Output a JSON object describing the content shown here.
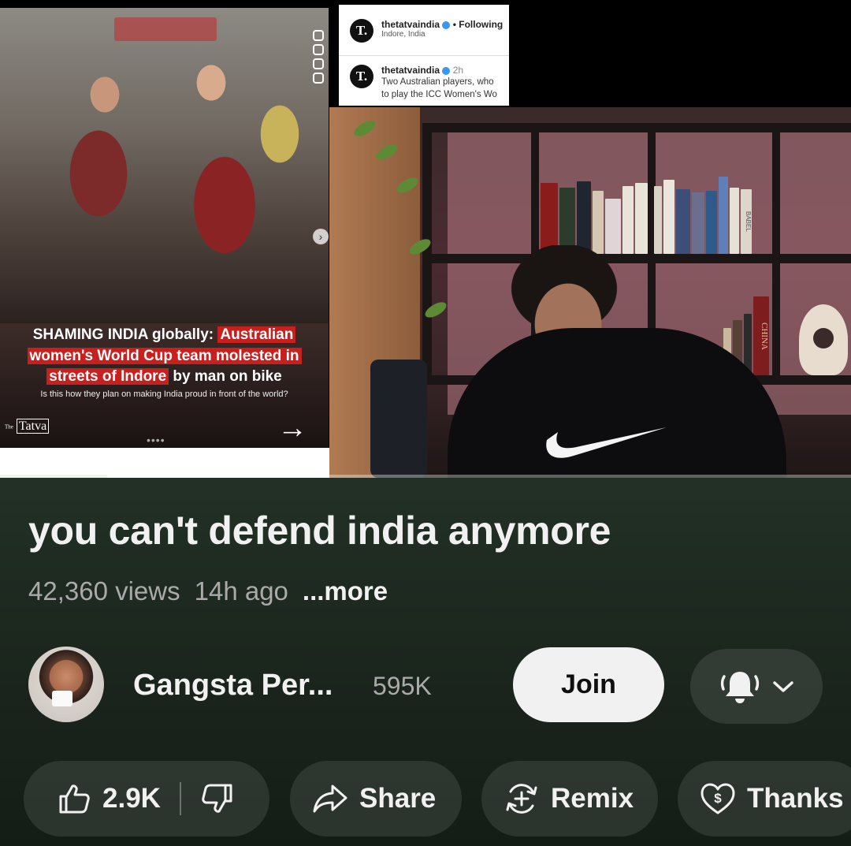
{
  "video": {
    "post_header": {
      "account": "thetatvaindia",
      "follow_status": "Following",
      "location": "Indore, India",
      "caption_account": "thetatvaindia",
      "caption_time": "2h",
      "caption_line1": "Two Australian players, who",
      "caption_line2": "to play the ICC Women's Wo"
    },
    "post": {
      "headline_part1": "SHAMING INDIA globally: ",
      "headline_hl1": "Australian",
      "headline_hl2": "women's World Cup team molested in",
      "headline_hl3": "streets of Indore",
      "headline_part4": " by man on bike",
      "subline": "Is this how they plan on making India proud in front of the world?",
      "logo_text": "Tatva",
      "logo_prefix": "The",
      "arrow": "→",
      "dots": "••••"
    },
    "studio": {
      "book_spine_1": "BABEL",
      "book_spine_2": "CHINA"
    },
    "progress_fraction": 0.126
  },
  "title": "you can't defend india anymore",
  "meta": {
    "views": "42,360 views",
    "age": "14h ago",
    "more": "...more"
  },
  "channel": {
    "name": "Gangsta Per...",
    "subscribers": "595K",
    "join_label": "Join",
    "bell_icon": "bell-ringing-icon",
    "chevron_icon": "chevron-down-icon"
  },
  "actions": {
    "like_count": "2.9K",
    "share_label": "Share",
    "remix_label": "Remix",
    "thanks_label": "Thanks"
  },
  "colors": {
    "headline_highlight": "#c8201f",
    "join_bg": "#f1f1f1",
    "page_bg": "#1f2a20",
    "verified": "#3897f0"
  }
}
